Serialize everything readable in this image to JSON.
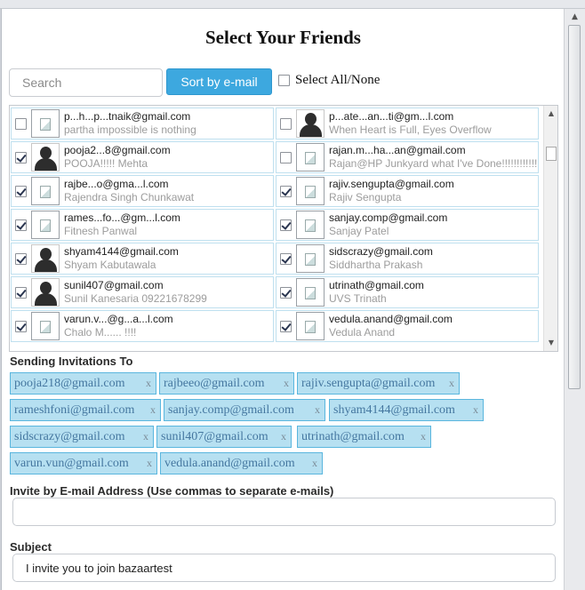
{
  "title": "Select Your Friends",
  "search": {
    "placeholder": "Search"
  },
  "sort_button": "Sort by e-mail",
  "select_all_label": "Select All/None",
  "friends": [
    [
      {
        "checked": false,
        "avatar": "broken-image-icon",
        "email": "p...h...p...tnaik@gmail.com",
        "name": "partha impossible is nothing"
      },
      {
        "checked": false,
        "avatar": "person-icon",
        "email": "p...ate...an...ti@gm...l.com",
        "name": "When Heart is Full, Eyes Overflow"
      }
    ],
    [
      {
        "checked": true,
        "avatar": "person-icon",
        "email": "pooja2...8@gmail.com",
        "name": "POOJA!!!!! Mehta"
      },
      {
        "checked": false,
        "avatar": "broken-image-icon",
        "email": "rajan.m...ha...an@gmail.com",
        "name": "Rajan@HP Junkyard what I've Done!!!!!!!!!!!!"
      }
    ],
    [
      {
        "checked": true,
        "avatar": "broken-image-icon",
        "email": "rajbe...o@gma...l.com",
        "name": "Rajendra Singh Chunkawat"
      },
      {
        "checked": true,
        "avatar": "broken-image-icon",
        "email": "rajiv.sengupta@gmail.com",
        "name": "Rajiv Sengupta"
      }
    ],
    [
      {
        "checked": true,
        "avatar": "broken-image-icon",
        "email": "rames...fo...@gm...l.com",
        "name": "Fitnesh Panwal"
      },
      {
        "checked": true,
        "avatar": "broken-image-icon",
        "email": "sanjay.comp@gmail.com",
        "name": "Sanjay Patel"
      }
    ],
    [
      {
        "checked": true,
        "avatar": "person-icon",
        "email": "shyam4144@gmail.com",
        "name": "Shyam Kabutawala"
      },
      {
        "checked": true,
        "avatar": "broken-image-icon",
        "email": "sidscrazy@gmail.com",
        "name": "Siddhartha Prakash"
      }
    ],
    [
      {
        "checked": true,
        "avatar": "person-icon",
        "email": "sunil407@gmail.com",
        "name": "Sunil Kanesaria 09221678299"
      },
      {
        "checked": true,
        "avatar": "broken-image-icon",
        "email": "utrinath@gmail.com",
        "name": "UVS Trinath"
      }
    ],
    [
      {
        "checked": true,
        "avatar": "broken-image-icon",
        "email": "varun.v...@g...a...l.com",
        "name": "Chalo M...... !!!!"
      },
      {
        "checked": true,
        "avatar": "broken-image-icon",
        "email": "vedula.anand@gmail.com",
        "name": "Vedula Anand"
      }
    ]
  ],
  "invitations_label": "Sending Invitations To",
  "invitations": [
    "pooja218@gmail.com",
    "rajbeeo@gmail.com",
    "rajiv.sengupta@gmail.com",
    "rameshfoni@gmail.com",
    "sanjay.comp@gmail.com",
    "shyam4144@gmail.com",
    "sidscrazy@gmail.com",
    "sunil407@gmail.com",
    "utrinath@gmail.com",
    "varun.vun@gmail.com",
    "vedula.anand@gmail.com"
  ],
  "remove_glyph": "x",
  "invite_label": "Invite by E-mail Address (Use commas to separate e-mails)",
  "invite_value": "",
  "subject_label": "Subject",
  "subject_value": "I invite you to join bazaartest"
}
